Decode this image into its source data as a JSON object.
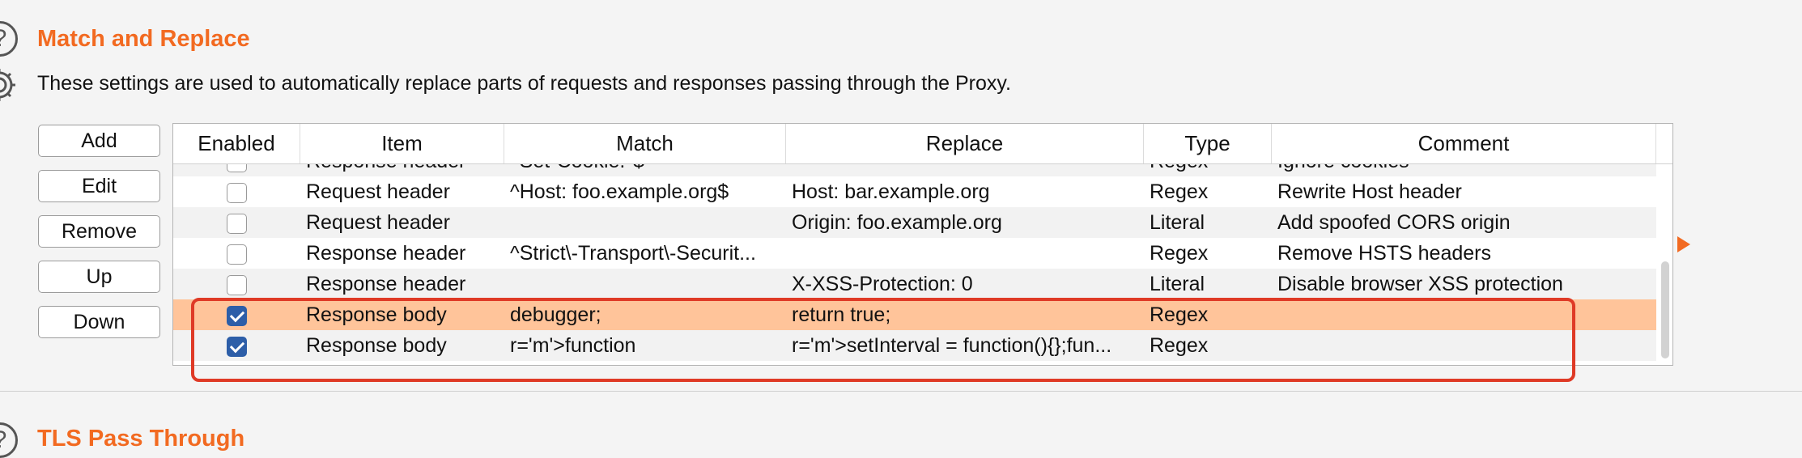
{
  "match_replace": {
    "title": "Match and Replace",
    "description": "These settings are used to automatically replace parts of requests and responses passing through the Proxy.",
    "buttons": {
      "add": "Add",
      "edit": "Edit",
      "remove": "Remove",
      "up": "Up",
      "down": "Down"
    },
    "columns": {
      "enabled": "Enabled",
      "item": "Item",
      "match": "Match",
      "replace": "Replace",
      "type": "Type",
      "comment": "Comment"
    },
    "rows": [
      {
        "enabled": false,
        "item": "Response header",
        "match": "^Set-Cookie.*$",
        "replace": "",
        "type": "Regex",
        "comment": "Ignore cookies"
      },
      {
        "enabled": false,
        "item": "Request header",
        "match": "^Host: foo.example.org$",
        "replace": "Host: bar.example.org",
        "type": "Regex",
        "comment": "Rewrite Host header"
      },
      {
        "enabled": false,
        "item": "Request header",
        "match": "",
        "replace": "Origin: foo.example.org",
        "type": "Literal",
        "comment": "Add spoofed CORS origin"
      },
      {
        "enabled": false,
        "item": "Response header",
        "match": "^Strict\\-Transport\\-Securit...",
        "replace": "",
        "type": "Regex",
        "comment": "Remove HSTS headers"
      },
      {
        "enabled": false,
        "item": "Response header",
        "match": "",
        "replace": "X-XSS-Protection: 0",
        "type": "Literal",
        "comment": "Disable browser XSS protection"
      },
      {
        "enabled": true,
        "item": "Response body",
        "match": "debugger;",
        "replace": "return true;",
        "type": "Regex",
        "comment": ""
      },
      {
        "enabled": true,
        "item": "Response body",
        "match": "r='m'>function",
        "replace": "r='m'>setInterval = function(){};fun...",
        "type": "Regex",
        "comment": ""
      }
    ],
    "selected_row": 5
  },
  "tls_pass_through": {
    "title": "TLS Pass Through"
  },
  "colors": {
    "accent": "#f26a21",
    "selected_row": "#ffc49a",
    "stripe_row": "#f2f2f2",
    "highlight_box": "#df3a26",
    "checkbox_checked": "#2d5ea8"
  }
}
